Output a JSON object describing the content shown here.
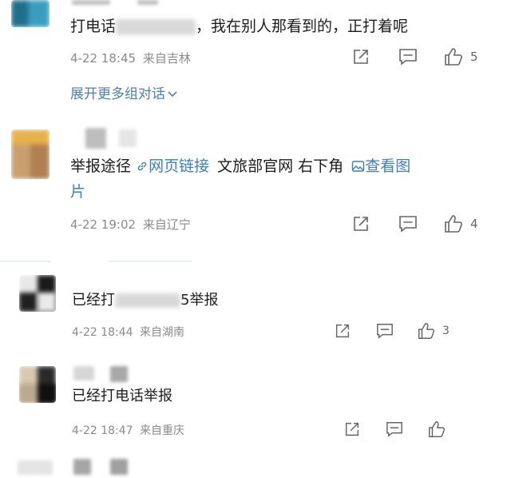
{
  "comments": [
    {
      "text_before": "打电话",
      "text_after": "，我在别人那看到的，正打着呢",
      "date": "4-22 18:45",
      "location": "来自吉林",
      "likes": "5",
      "expand_label": "展开更多组对话"
    },
    {
      "text1": "举报途径",
      "link1": "网页链接",
      "text2": "文旅部官网 右下角",
      "link2": "查看图",
      "text_line2": "片",
      "date": "4-22 19:02",
      "location": "来自辽宁",
      "likes": "4"
    },
    {
      "text_before": "已经打",
      "text_after": "5举报",
      "date": "4-22 18:44",
      "location": "来自湖南",
      "likes": "3"
    },
    {
      "text": "已经打电话举报",
      "date": "4-22 18:47",
      "location": "来自重庆"
    }
  ],
  "icons": [
    "share-icon",
    "comment-icon",
    "like-icon",
    "link-icon",
    "image-icon",
    "chevron-down-icon"
  ],
  "colors": {
    "link": "#3d7fc2",
    "meta": "#8a8a8a",
    "text": "#1c1c1c"
  }
}
